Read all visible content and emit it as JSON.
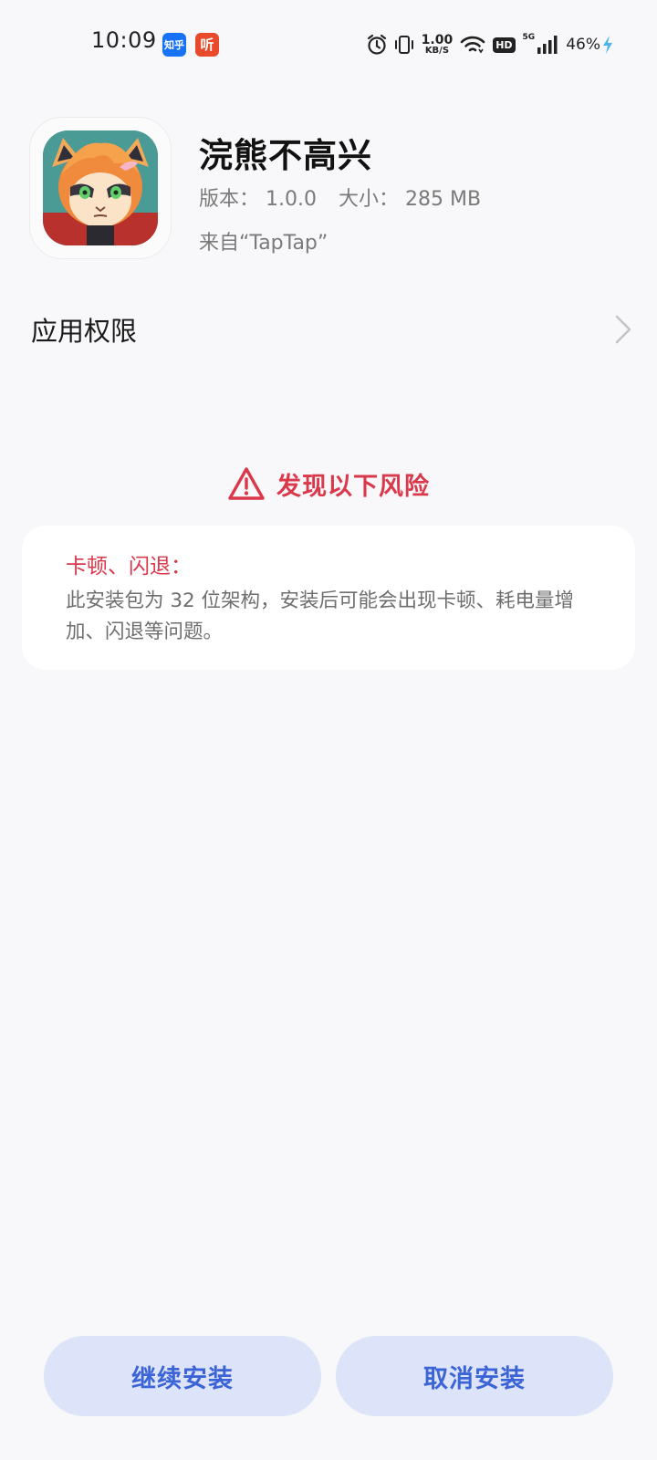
{
  "status_bar": {
    "time": "10:09",
    "notif_zhihu": "知乎",
    "notif_ting": "听",
    "net_speed_value": "1.00",
    "net_speed_unit": "KB/S",
    "hd_label": "HD",
    "network_type": "5G",
    "battery": "46%",
    "icons": [
      "alarm-icon",
      "vibrate-icon",
      "wifi-icon",
      "signal-icon",
      "charging-icon"
    ]
  },
  "app": {
    "name": "浣熊不高兴",
    "version_label": "版本：",
    "version": "1.0.0",
    "size_label": "大小：",
    "size": "285 MB",
    "source": "来自“TapTap”"
  },
  "permissions": {
    "label": "应用权限"
  },
  "risk": {
    "title": "发现以下风险",
    "item_title": "卡顿、闪退：",
    "item_desc": "此安装包为 32 位架构，安装后可能会出现卡顿、耗电量增加、闪退等问题。",
    "accent_color": "#d9394b"
  },
  "actions": {
    "continue_label": "继续安装",
    "cancel_label": "取消安装",
    "button_color": "#3b64d6"
  }
}
